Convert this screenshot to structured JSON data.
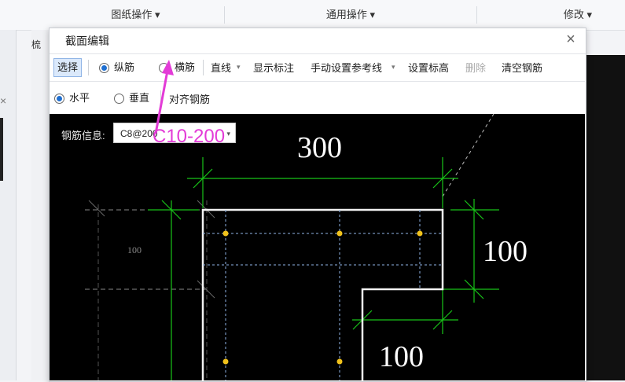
{
  "ribbon": {
    "group1": "图纸操作 ▾",
    "group2": "通用操作 ▾",
    "group3": "修改 ▾"
  },
  "left": {
    "fragment": "梳",
    "close_glyph": "×"
  },
  "dialog": {
    "title": "截面编辑",
    "close": "×",
    "toolbar1": {
      "select": "选择",
      "longitudinal": "纵筋",
      "transverse": "横筋",
      "line": "直线",
      "line_arrow": "▾",
      "show_dim": "显示标注",
      "manual_ref": "手动设置参考线",
      "manual_ref_arrow": "▾",
      "set_elev": "设置标高",
      "delete": "删除",
      "clear": "清空钢筋"
    },
    "toolbar2": {
      "horizontal": "水平",
      "vertical": "垂直",
      "align": "对齐钢筋"
    },
    "rebar_info_label": "钢筋信息:",
    "rebar_info_value": "C8@200",
    "rebar_info_arrow": "▾"
  },
  "drawing": {
    "dim_top": "300",
    "dim_right": "100",
    "dim_bottom": "100",
    "dim_left_small": "100"
  },
  "annotation": {
    "text": "C10-200",
    "color": "#e33bd7"
  }
}
